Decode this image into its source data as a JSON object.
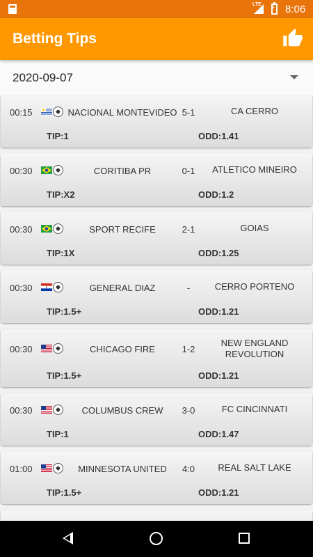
{
  "status_bar": {
    "network": "LTE",
    "time": "8:06"
  },
  "app_bar": {
    "title": "Betting Tips"
  },
  "date_selector": {
    "value": "2020-09-07"
  },
  "matches": [
    {
      "time": "00:15",
      "flag": "uruguay",
      "home": "NACIONAL MONTEVIDEO",
      "score": "5-1",
      "away": "CA CERRO",
      "tip": "TIP:1",
      "odd": "ODD:1.41"
    },
    {
      "time": "00:30",
      "flag": "brazil",
      "home": "CORITIBA PR",
      "score": "0-1",
      "away": "ATLETICO MINEIRO",
      "tip": "TIP:X2",
      "odd": "ODD:1.2"
    },
    {
      "time": "00:30",
      "flag": "brazil",
      "home": "SPORT RECIFE",
      "score": "2-1",
      "away": "GOIAS",
      "tip": "TIP:1X",
      "odd": "ODD:1.25"
    },
    {
      "time": "00:30",
      "flag": "paraguay",
      "home": "GENERAL DIAZ",
      "score": "-",
      "away": "CERRO PORTENO",
      "tip": "TIP:1.5+",
      "odd": "ODD:1.21"
    },
    {
      "time": "00:30",
      "flag": "usa",
      "home": "CHICAGO FIRE",
      "score": "1-2",
      "away": "NEW ENGLAND REVOLUTION",
      "tip": "TIP:1.5+",
      "odd": "ODD:1.21"
    },
    {
      "time": "00:30",
      "flag": "usa",
      "home": "COLUMBUS CREW",
      "score": "3-0",
      "away": "FC CINCINNATI",
      "tip": "TIP:1",
      "odd": "ODD:1.47"
    },
    {
      "time": "01:00",
      "flag": "usa",
      "home": "MINNESOTA UNITED",
      "score": "4:0",
      "away": "REAL SALT LAKE",
      "tip": "TIP:1.5+",
      "odd": "ODD:1.21"
    }
  ],
  "colors": {
    "status_bar": "#e8740a",
    "app_bar": "#ff9800"
  }
}
